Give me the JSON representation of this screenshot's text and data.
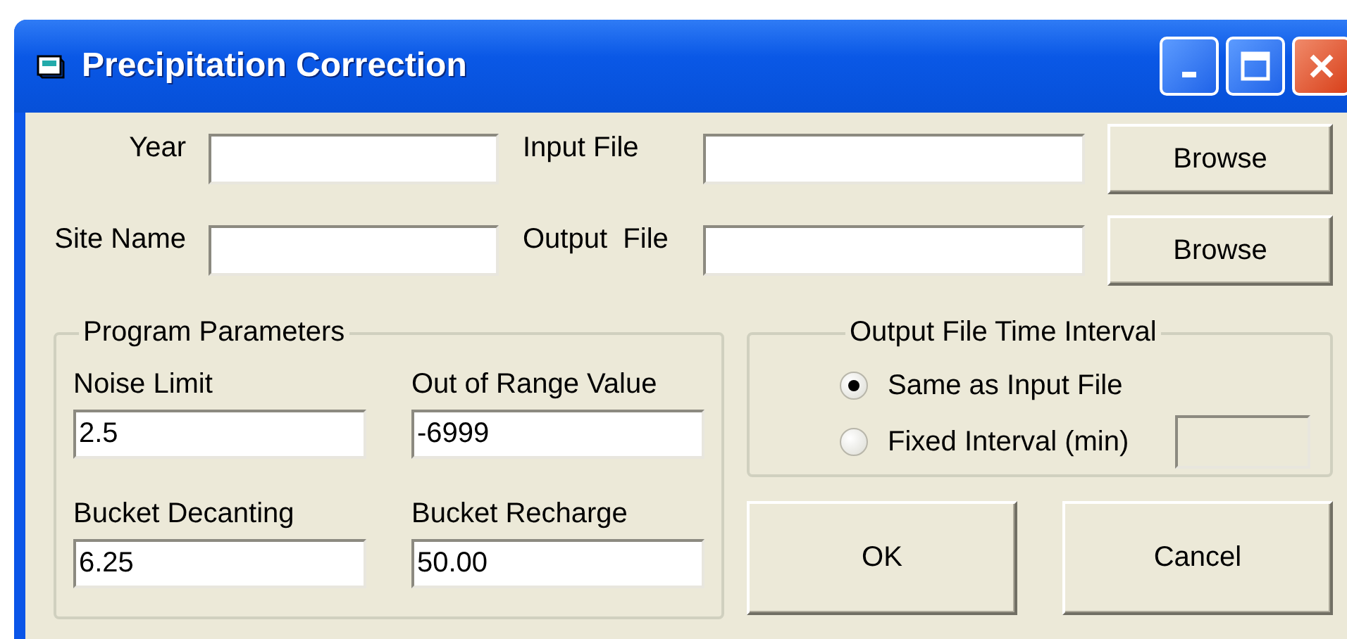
{
  "window": {
    "title": "Precipitation Correction"
  },
  "file_rows": [
    {
      "left_label": "Year",
      "right_label": "Input File",
      "button": "Browse"
    },
    {
      "left_label": "Site Name",
      "right_label": "Output  File",
      "button": "Browse"
    }
  ],
  "program_parameters": {
    "title": "Program Parameters",
    "fields": [
      {
        "label": "Noise Limit",
        "value": "2.5"
      },
      {
        "label": "Out of Range Value",
        "value": "-6999"
      },
      {
        "label": "Bucket Decanting",
        "value": "6.25"
      },
      {
        "label": "Bucket Recharge",
        "value": "50.00"
      }
    ]
  },
  "output_interval": {
    "title": "Output File Time Interval",
    "options": [
      {
        "label": "Same as Input File",
        "selected": true
      },
      {
        "label": "Fixed Interval (min)",
        "selected": false
      }
    ],
    "interval_field": {
      "disabled": true
    }
  },
  "buttons": [
    "OK",
    "Cancel"
  ]
}
